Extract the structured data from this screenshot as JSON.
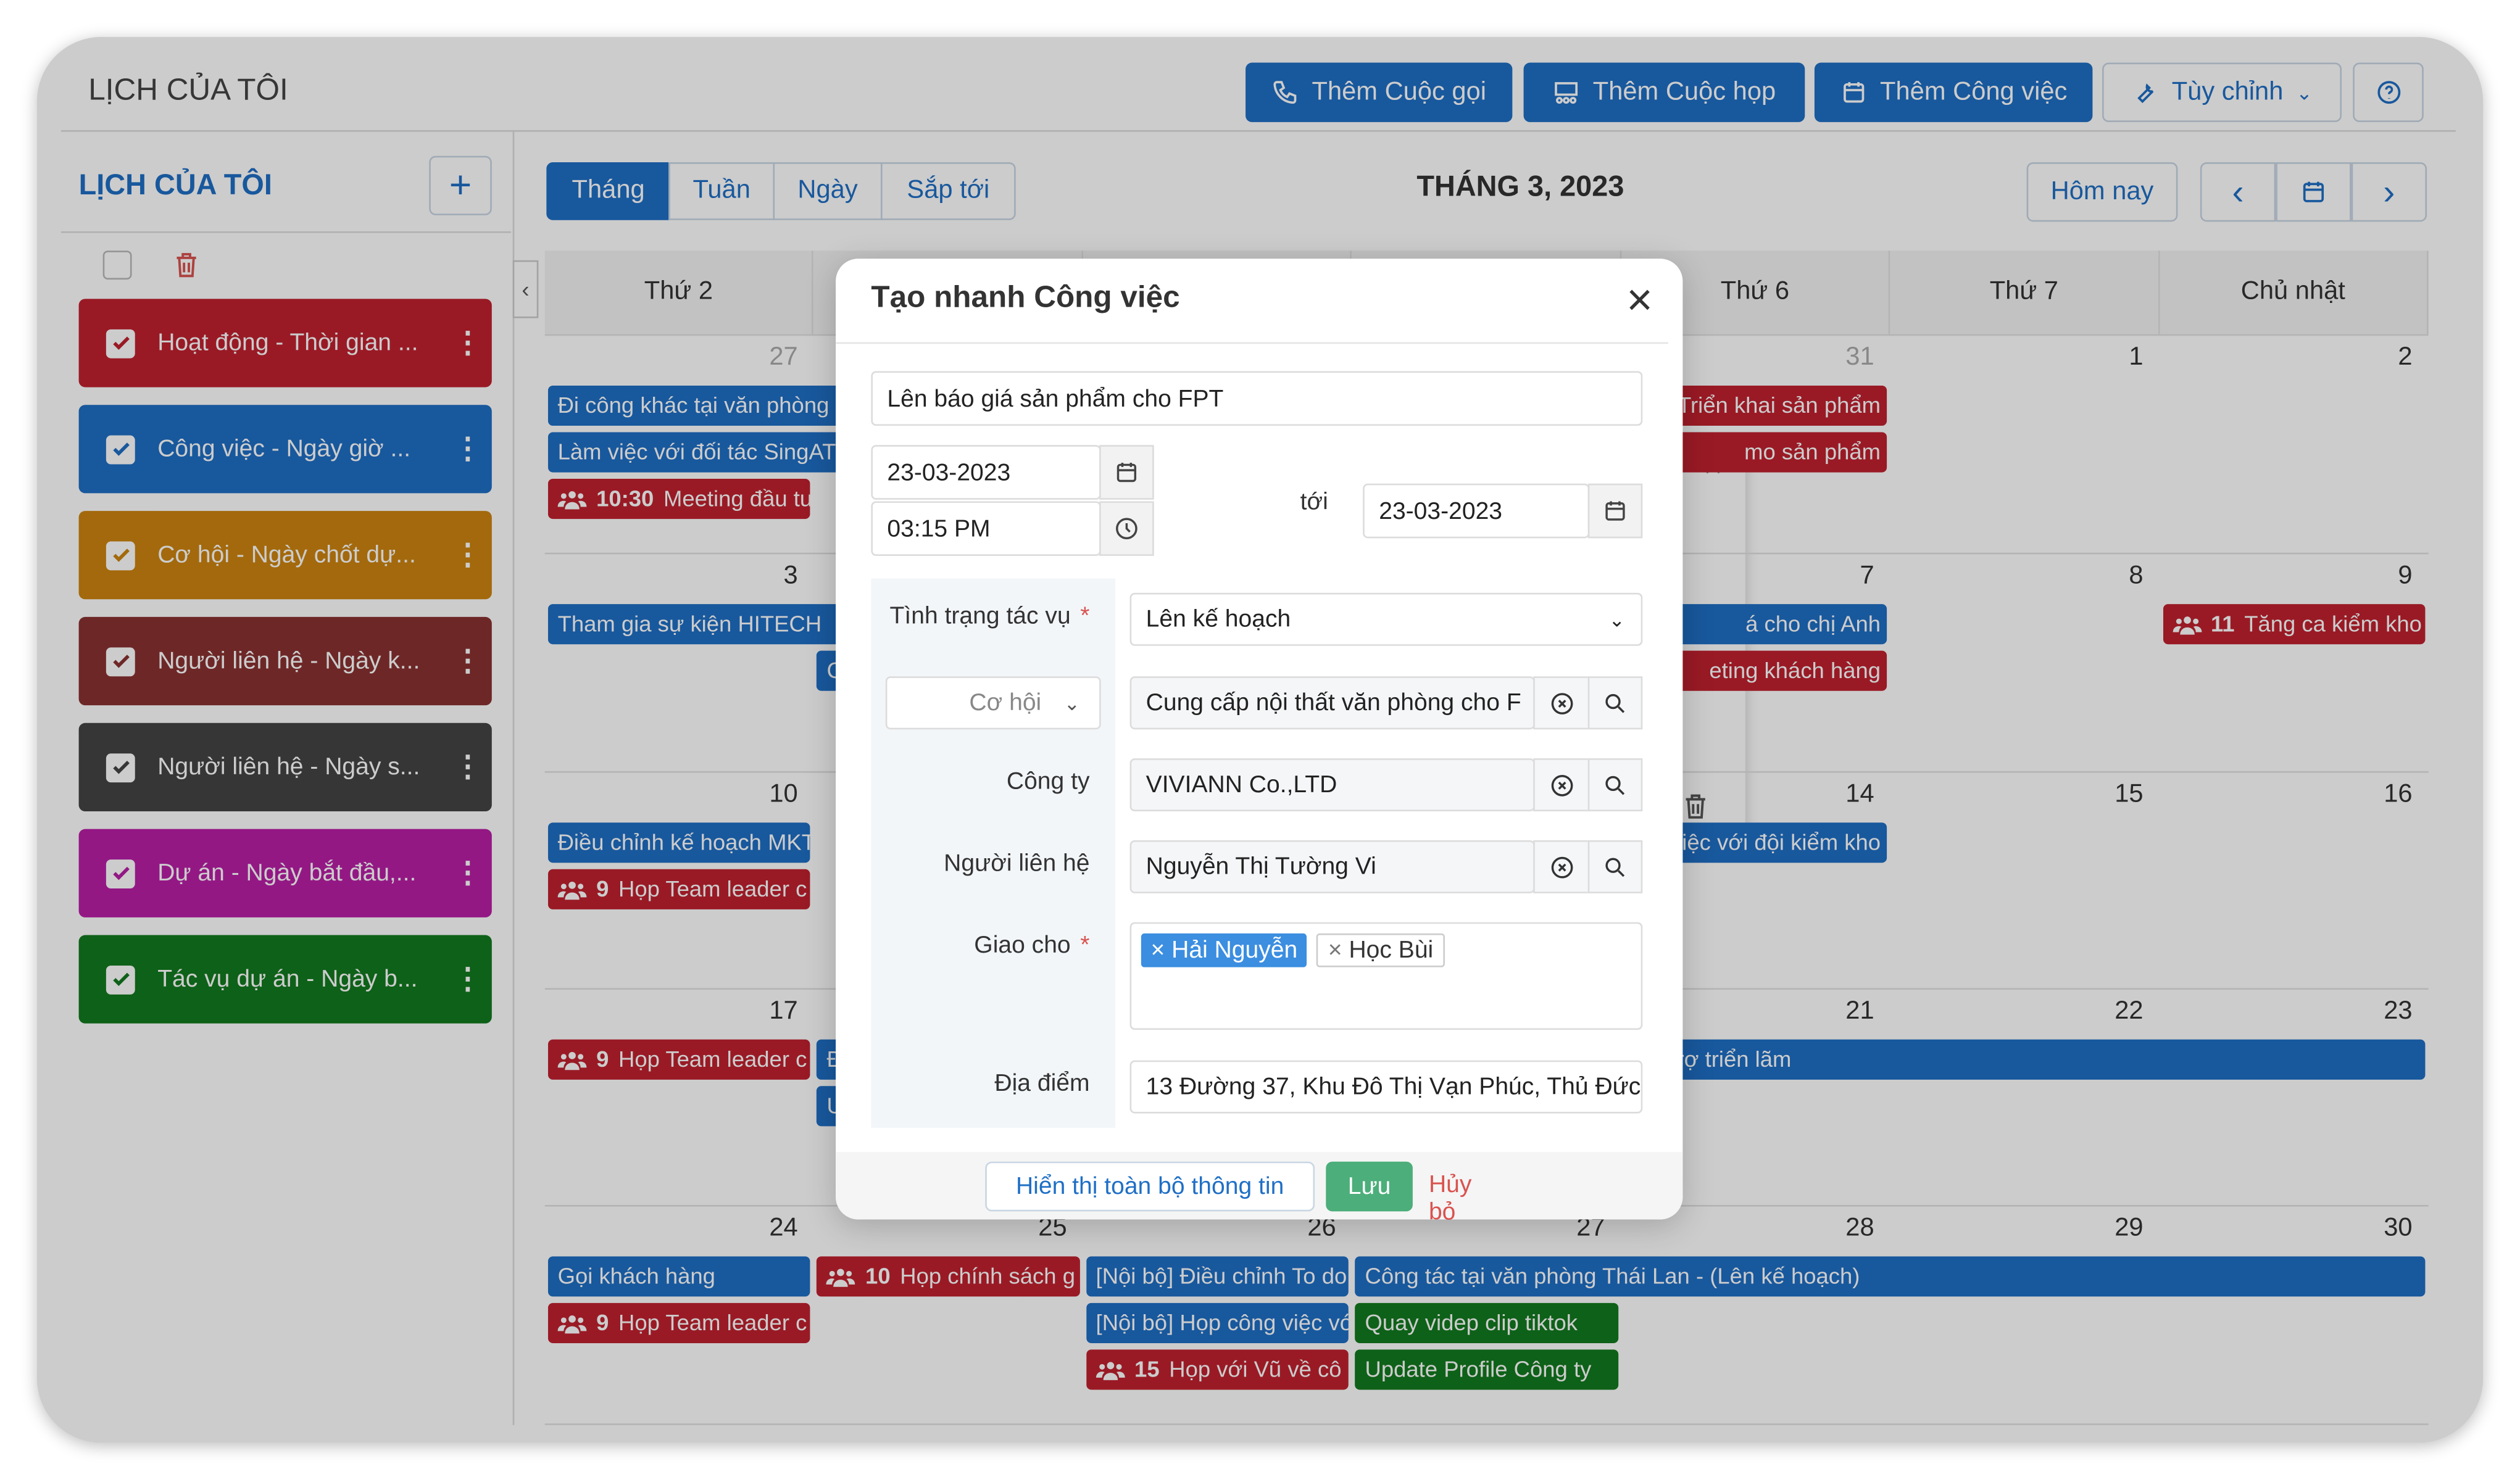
{
  "header": {
    "title": "LỊCH CỦA TÔI",
    "buttons": [
      {
        "label": "Thêm Cuộc gọi",
        "icon": "phone-icon"
      },
      {
        "label": "Thêm Cuộc họp",
        "icon": "meeting-icon"
      },
      {
        "label": "Thêm Công việc",
        "icon": "calendar-icon"
      },
      {
        "label": "Tùy chỉnh",
        "icon": "wrench-icon"
      }
    ],
    "help_icon": "help-icon"
  },
  "sidebar": {
    "title": "LỊCH CỦA TÔI",
    "items": [
      {
        "label": "Hoạt động - Thời gian ...",
        "color": "#c0212f",
        "checked": true
      },
      {
        "label": "Công việc - Ngày giờ ...",
        "color": "#1f6fc5",
        "checked": true
      },
      {
        "label": "Cơ hội - Ngày chốt dự...",
        "color": "#cc8410",
        "checked": true
      },
      {
        "label": "Người liên hệ - Ngày k...",
        "color": "#8a3131",
        "checked": true
      },
      {
        "label": "Người liên hệ - Ngày s...",
        "color": "#444444",
        "checked": true
      },
      {
        "label": "Dự án - Ngày bắt đầu,...",
        "color": "#b81ea6",
        "checked": true
      },
      {
        "label": "Tác vụ dự án - Ngày b...",
        "color": "#127a1e",
        "checked": true
      }
    ]
  },
  "toolbar": {
    "tabs": [
      "Tháng",
      "Tuần",
      "Ngày",
      "Sắp tới"
    ],
    "active_tab": 0,
    "month_title": "THÁNG 3, 2023",
    "today": "Hôm nay"
  },
  "calendar": {
    "weekdays": [
      "Thứ 2",
      "",
      "",
      "",
      "Thứ 6",
      "Thứ 7",
      "Chủ nhật"
    ],
    "weeks": [
      [
        {
          "d": "27",
          "muted": true
        },
        null,
        null,
        null,
        {
          "d": "31",
          "muted": true
        },
        {
          "d": "1"
        },
        {
          "d": "2"
        }
      ],
      [
        {
          "d": "3"
        },
        null,
        null,
        null,
        {
          "d": "7"
        },
        {
          "d": "8"
        },
        {
          "d": "9"
        }
      ],
      [
        {
          "d": "10"
        },
        null,
        null,
        null,
        {
          "d": "14"
        },
        {
          "d": "15"
        },
        {
          "d": "16"
        }
      ],
      [
        {
          "d": "17"
        },
        null,
        null,
        null,
        {
          "d": "21"
        },
        {
          "d": "22"
        },
        {
          "d": "23"
        }
      ],
      [
        {
          "d": "24"
        },
        {
          "d": "25"
        },
        {
          "d": "26"
        },
        {
          "d": "27"
        },
        {
          "d": "28"
        },
        {
          "d": "29"
        },
        {
          "d": "30"
        }
      ]
    ],
    "events": [
      {
        "w": 0,
        "c": 0,
        "span": 2,
        "slot": 0,
        "type": "task",
        "text": "Đi công khác tại văn phòng S"
      },
      {
        "w": 0,
        "c": 0,
        "span": 2,
        "slot": 1,
        "type": "task",
        "text": "Làm việc với đối tác SingATI"
      },
      {
        "w": 0,
        "c": 0,
        "span": 1,
        "slot": 2,
        "type": "meeting",
        "time": "10:30",
        "text": "Meeting đầu tuần"
      },
      {
        "w": 0,
        "c": 4,
        "span": 1,
        "slot": 0,
        "type": "meeting-plain",
        "time": "10",
        "text": "Triển khai sản phẩm",
        "align": "right"
      },
      {
        "w": 0,
        "c": 4,
        "span": 1,
        "slot": 1,
        "type": "activity",
        "text": "mo sản phẩm",
        "align": "right"
      },
      {
        "w": 1,
        "c": 0,
        "span": 2,
        "slot": 0,
        "type": "task",
        "text": "Tham gia sự kiện HITECH"
      },
      {
        "w": 1,
        "c": 1,
        "span": 1,
        "slot": 1,
        "type": "task",
        "text": "C"
      },
      {
        "w": 1,
        "c": 4,
        "span": 1,
        "slot": 0,
        "type": "task",
        "text": "á cho chị Anh",
        "align": "right"
      },
      {
        "w": 1,
        "c": 4,
        "span": 1,
        "slot": 1,
        "type": "activity",
        "text": "eting khách hàng",
        "align": "right"
      },
      {
        "w": 1,
        "c": 6,
        "span": 1,
        "slot": 0,
        "type": "meeting",
        "time": "11",
        "text": "Tăng ca kiểm kho"
      },
      {
        "w": 2,
        "c": 0,
        "span": 1,
        "slot": 0,
        "type": "task",
        "text": "Điều chỉnh kế hoạch MKT"
      },
      {
        "w": 2,
        "c": 0,
        "span": 1,
        "slot": 1,
        "type": "meeting",
        "time": "9",
        "text": "Họp Team leader c"
      },
      {
        "w": 2,
        "c": 4,
        "span": 1,
        "slot": 0,
        "type": "task",
        "text": "việc với đội kiểm kho",
        "align": "right"
      },
      {
        "w": 3,
        "c": 0,
        "span": 1,
        "slot": 0,
        "type": "meeting",
        "time": "9",
        "text": "Họp Team leader c"
      },
      {
        "w": 3,
        "c": 1,
        "span": 1,
        "slot": 0,
        "type": "task",
        "text": "Đ"
      },
      {
        "w": 3,
        "c": 1,
        "span": 1,
        "slot": 1,
        "type": "task",
        "text": "U"
      },
      {
        "w": 3,
        "c": 4,
        "span": 3,
        "slot": 0,
        "type": "task",
        "text": "hội trợ triển lãm"
      },
      {
        "w": 4,
        "c": 0,
        "span": 1,
        "slot": 0,
        "type": "task",
        "text": "Gọi khách hàng"
      },
      {
        "w": 4,
        "c": 0,
        "span": 1,
        "slot": 1,
        "type": "meeting",
        "time": "9",
        "text": "Họp Team leader c"
      },
      {
        "w": 4,
        "c": 1,
        "span": 1,
        "slot": 0,
        "type": "meeting",
        "time": "10",
        "text": "Họp chính sách g"
      },
      {
        "w": 4,
        "c": 2,
        "span": 1,
        "slot": 0,
        "type": "task",
        "text": "[Nội bộ] Điều chỉnh To do"
      },
      {
        "w": 4,
        "c": 2,
        "span": 1,
        "slot": 1,
        "type": "task",
        "text": "[Nội bộ] Họp công việc với"
      },
      {
        "w": 4,
        "c": 2,
        "span": 1,
        "slot": 2,
        "type": "meeting",
        "time": "15",
        "text": "Họp với Vũ về cô"
      },
      {
        "w": 4,
        "c": 3,
        "span": 4,
        "slot": 0,
        "type": "task",
        "text": "Công tác tại văn phòng Thái Lan - (Lên kế hoạch)"
      },
      {
        "w": 4,
        "c": 3,
        "span": 1,
        "slot": 1,
        "type": "project",
        "text": "Quay videp clip tiktok"
      },
      {
        "w": 4,
        "c": 3,
        "span": 1,
        "slot": 2,
        "type": "project",
        "text": "Update Profile Công ty"
      }
    ],
    "colors": {
      "task": "#1f6fc5",
      "meeting": "#c0212f",
      "meeting-plain": "#c0212f",
      "activity": "#c0212f",
      "project": "#127a1e"
    }
  },
  "modal": {
    "title": "Tạo nhanh Công việc",
    "subject": "Lên báo giá sản phẩm cho FPT",
    "start_date": "23-03-2023",
    "start_time": "03:15 PM",
    "to_label": "tới",
    "end_date": "23-03-2023",
    "status_label": "Tình trạng tác vụ",
    "status_value": "Lên kế hoạch",
    "related_type": "Cơ hội",
    "related_value": "Cung cấp nội thất văn phòng cho F",
    "company_label": "Công ty",
    "company_value": "VIVIANN Co.,LTD",
    "contact_label": "Người liên hệ",
    "contact_value": "Nguyễn Thị Tường Vi",
    "assign_label": "Giao cho",
    "assignees": [
      {
        "name": "Hải Nguyễn",
        "selected": true
      },
      {
        "name": "Học Bùi",
        "selected": false
      }
    ],
    "location_label": "Địa điểm",
    "location_value": "13 Đường 37, Khu Đô Thị Vạn Phúc, Thủ Đức",
    "required_mark": "*",
    "show_all": "Hiển thị toàn bộ thông tin",
    "save": "Lưu",
    "cancel": "Hủy bỏ"
  }
}
